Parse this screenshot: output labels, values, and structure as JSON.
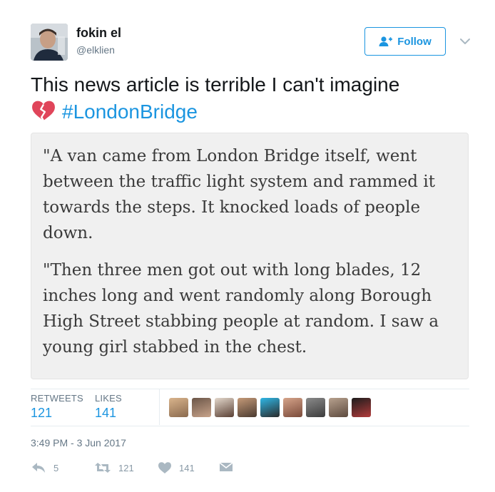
{
  "author": {
    "display_name": "fokin el",
    "handle": "@elklien",
    "follow_label": "Follow"
  },
  "tweet": {
    "text": "This news article is terrible I can't imagine",
    "hashtag": "#LondonBridge",
    "emoji": "broken-heart-icon"
  },
  "quote": {
    "paragraphs": [
      "\"A van came from London Bridge itself, went between the traffic light system and rammed it towards the steps. It knocked loads of people down.",
      "\"Then three men got out with long blades, 12 inches long and went randomly along Borough High Street stabbing people at random. I saw a young girl stabbed in the chest."
    ]
  },
  "stats": {
    "retweets_label": "RETWEETS",
    "retweets_value": "121",
    "likes_label": "LIKES",
    "likes_value": "141"
  },
  "timestamp": "3:49 PM - 3 Jun 2017",
  "actions": {
    "reply_count": "5",
    "retweet_count": "121",
    "like_count": "141"
  },
  "colors": {
    "accent": "#1b95e0",
    "muted": "#657786",
    "emoji": "#e0455a"
  }
}
